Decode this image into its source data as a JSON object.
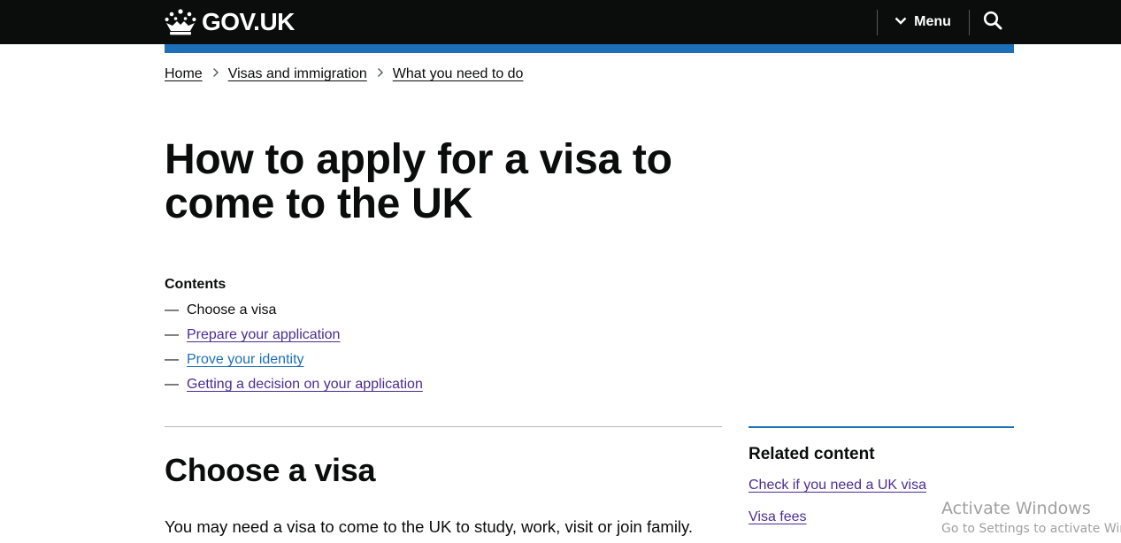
{
  "header": {
    "logo_text": "GOV.UK",
    "menu_label": "Menu",
    "logo_icon": "crown-icon",
    "menu_icon": "chevron-down-icon",
    "search_icon": "search-icon",
    "background_color": "#0b0c0c",
    "accent_bar_color": "#1d70b8"
  },
  "breadcrumb": {
    "items": [
      {
        "label": "Home"
      },
      {
        "label": "Visas and immigration"
      },
      {
        "label": "What you need to do"
      }
    ],
    "separator_icon": "chevron-right-icon"
  },
  "page": {
    "title": "How to apply for a visa to come to the UK"
  },
  "contents": {
    "heading": "Contents",
    "dash": "—",
    "items": [
      {
        "label": "Choose a visa",
        "current": true
      },
      {
        "label": "Prepare your application",
        "current": false
      },
      {
        "label": "Prove your identity",
        "current": false
      },
      {
        "label": "Getting a decision on your application",
        "current": false
      }
    ]
  },
  "section": {
    "heading": "Choose a visa",
    "body": "You may need a visa to come to the UK to study, work, visit or join family."
  },
  "related": {
    "heading": "Related content",
    "links": [
      {
        "label": "Check if you need a UK visa"
      },
      {
        "label": "Visa fees"
      }
    ]
  },
  "watermark": {
    "title": "Activate Windows",
    "subtitle": "Go to Settings to activate Windows."
  },
  "colors": {
    "link_visited": "#4c2c92",
    "link": "#1d70b8",
    "text": "#0b0c0c",
    "rule": "#b1b4b6"
  }
}
